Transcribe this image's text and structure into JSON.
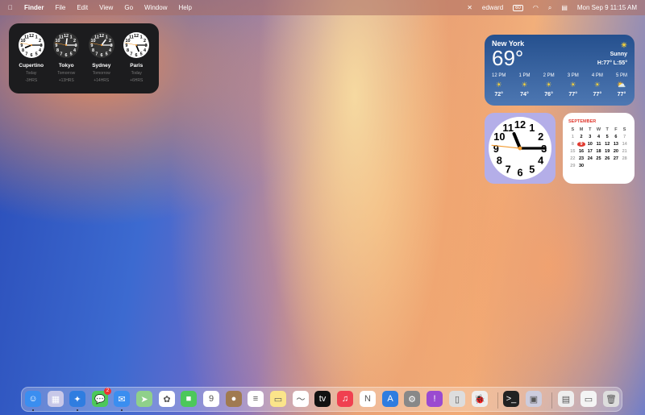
{
  "menubar": {
    "apple": "",
    "app": "Finder",
    "items": [
      "File",
      "Edit",
      "View",
      "Go",
      "Window",
      "Help"
    ],
    "user": "edward",
    "battery": "60",
    "datetime": "Mon Sep 9  11:15 AM"
  },
  "world_clock": [
    {
      "city": "Cupertino",
      "day": "Today",
      "offset": "-3HRS",
      "h": 8,
      "m": 15,
      "dark": false
    },
    {
      "city": "Tokyo",
      "day": "Tomorrow",
      "offset": "+13HRS",
      "h": 0,
      "m": 15,
      "dark": true
    },
    {
      "city": "Sydney",
      "day": "Tomorrow",
      "offset": "+14HRS",
      "h": 1,
      "m": 15,
      "dark": true
    },
    {
      "city": "Paris",
      "day": "Today",
      "offset": "+6HRS",
      "h": 5,
      "m": 15,
      "dark": false
    }
  ],
  "weather": {
    "city": "New York",
    "temp": "69°",
    "condition": "Sunny",
    "hilo": "H:77° L:55°",
    "hourly": [
      {
        "time": "12 PM",
        "icon": "sun",
        "temp": "72°"
      },
      {
        "time": "1 PM",
        "icon": "sun",
        "temp": "74°"
      },
      {
        "time": "2 PM",
        "icon": "sun",
        "temp": "76°"
      },
      {
        "time": "3 PM",
        "icon": "sun",
        "temp": "77°"
      },
      {
        "time": "4 PM",
        "icon": "sun",
        "temp": "77°"
      },
      {
        "time": "5 PM",
        "icon": "partly-cloudy",
        "temp": "77°"
      }
    ]
  },
  "clock": {
    "h": 11,
    "m": 15,
    "s": 46
  },
  "calendar": {
    "month": "SEPTEMBER",
    "weekdays": [
      "S",
      "M",
      "T",
      "W",
      "T",
      "F",
      "S"
    ],
    "days": [
      "1",
      "2",
      "3",
      "4",
      "5",
      "6",
      "7",
      "8",
      "9",
      "10",
      "11",
      "12",
      "13",
      "14",
      "15",
      "16",
      "17",
      "18",
      "19",
      "20",
      "21",
      "22",
      "23",
      "24",
      "25",
      "26",
      "27",
      "28",
      "29",
      "30"
    ],
    "today": "9"
  },
  "dock": [
    {
      "name": "finder",
      "bg": "#3a8ef0",
      "g": "☺",
      "run": true
    },
    {
      "name": "launchpad",
      "bg": "#c8c8e8",
      "g": "▦"
    },
    {
      "name": "safari",
      "bg": "#2f7de0",
      "g": "✦",
      "run": true
    },
    {
      "name": "messages",
      "bg": "#4cc85a",
      "g": "💬",
      "badge": "2"
    },
    {
      "name": "mail",
      "bg": "#3a8ef0",
      "g": "✉",
      "run": true
    },
    {
      "name": "maps",
      "bg": "#8fd08a",
      "g": "➤"
    },
    {
      "name": "photos",
      "bg": "#fff",
      "g": "✿"
    },
    {
      "name": "facetime",
      "bg": "#4cc85a",
      "g": "■"
    },
    {
      "name": "calendar",
      "bg": "#fff",
      "g": "9"
    },
    {
      "name": "contacts",
      "bg": "#a07a50",
      "g": "●"
    },
    {
      "name": "reminders",
      "bg": "#fff",
      "g": "≡"
    },
    {
      "name": "notes",
      "bg": "#fbe58a",
      "g": "▭"
    },
    {
      "name": "freeform",
      "bg": "#fff",
      "g": "〜"
    },
    {
      "name": "tv",
      "bg": "#111",
      "g": "tv"
    },
    {
      "name": "music",
      "bg": "#f04050",
      "g": "♫"
    },
    {
      "name": "news",
      "bg": "#fff",
      "g": "N"
    },
    {
      "name": "app-store",
      "bg": "#2f7de0",
      "g": "A"
    },
    {
      "name": "system-settings",
      "bg": "#888",
      "g": "⚙"
    },
    {
      "name": "feedback",
      "bg": "#9a4ad0",
      "g": "!"
    },
    {
      "name": "iphone-mirroring",
      "bg": "#ddd",
      "g": "▯"
    },
    {
      "name": "bug-app",
      "bg": "#eee",
      "g": "🐞"
    },
    {
      "name": "terminal",
      "bg": "#222",
      "g": ">_"
    },
    {
      "name": "preview",
      "bg": "#ccd",
      "g": "▣"
    },
    {
      "name": "downloads-stack",
      "bg": "#eee",
      "g": "▤"
    },
    {
      "name": "screenshot-stack",
      "bg": "#f4f4f4",
      "g": "▭"
    },
    {
      "name": "trash",
      "bg": "#ddd",
      "g": "🗑"
    }
  ]
}
